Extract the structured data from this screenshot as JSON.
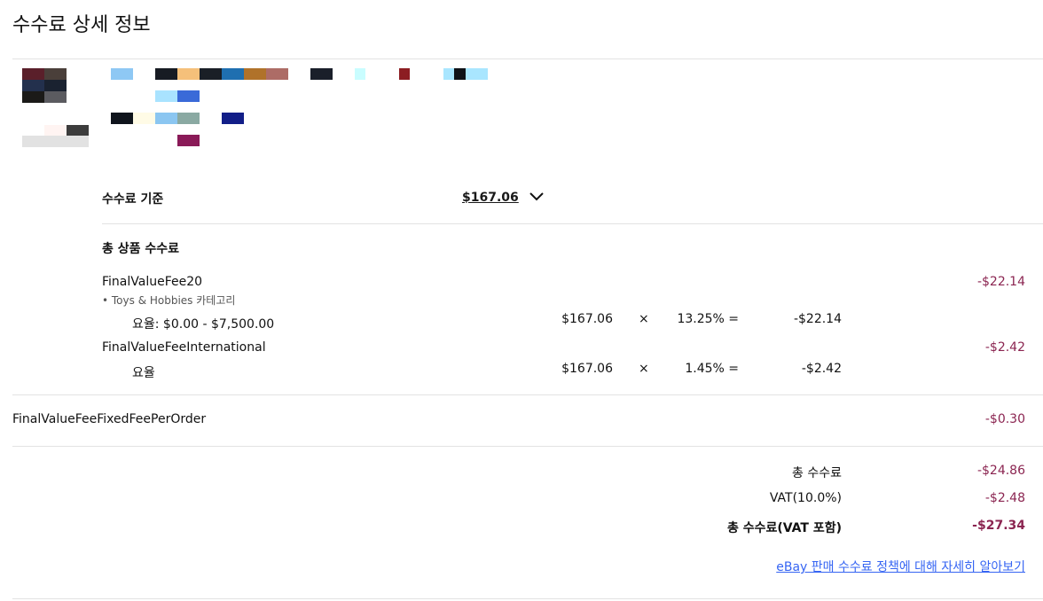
{
  "page": {
    "title": "수수료 상세 정보"
  },
  "listing": {
    "thumbnail_colors": [
      "#5a1f2a",
      "#4a3f3a",
      "#23304d",
      "#1a2230",
      "#1b1a18",
      "#5b5b60",
      "#fff4f2",
      "#3c3c3c",
      "#e2e2e2"
    ],
    "title_colors": [
      "#8ec8f4",
      "#171b23",
      "#f5c07a",
      "#1a1f26",
      "#1f6fb0",
      "#b0722a",
      "#ad6c66",
      "#1a1f2a",
      "#c9fdff",
      "#8c1d22",
      "#a9e6ff",
      "#0f1217",
      "#a9e6ff",
      "#a9e3ff",
      "#3a6ad8",
      "#0f141c",
      "#fffbe6",
      "#8bc6f1",
      "#8aa9a2",
      "#121e88",
      "#8a1a58"
    ]
  },
  "basis": {
    "label": "수수료 기준",
    "amount": "$167.06"
  },
  "total_item_fees": {
    "heading": "총 상품 수수료"
  },
  "fees": [
    {
      "name": "FinalValueFee20",
      "category": "• Toys & Hobbies 카테고리",
      "rate_label": "요율: $0.00 - $7,500.00",
      "base": "$167.06",
      "times": "×",
      "rate": "13.25% =",
      "result": "-$22.14",
      "total": "-$22.14"
    },
    {
      "name": "FinalValueFeeInternational",
      "rate_label": "요율",
      "base": "$167.06",
      "times": "×",
      "rate": "1.45% =",
      "result": "-$2.42",
      "total": "-$2.42"
    }
  ],
  "fixed_fee": {
    "name": "FinalValueFeeFixedFeePerOrder",
    "total": "-$0.30"
  },
  "summary": {
    "total_fee_label": "총 수수료",
    "total_fee": "-$24.86",
    "vat_label": "VAT(10.0%)",
    "vat": "-$2.48",
    "grand_total_label": "총 수수료(VAT 포함)",
    "grand_total": "-$27.34"
  },
  "policy_link": "eBay 판매 수수료 정책에 대해 자세히 알아보기"
}
